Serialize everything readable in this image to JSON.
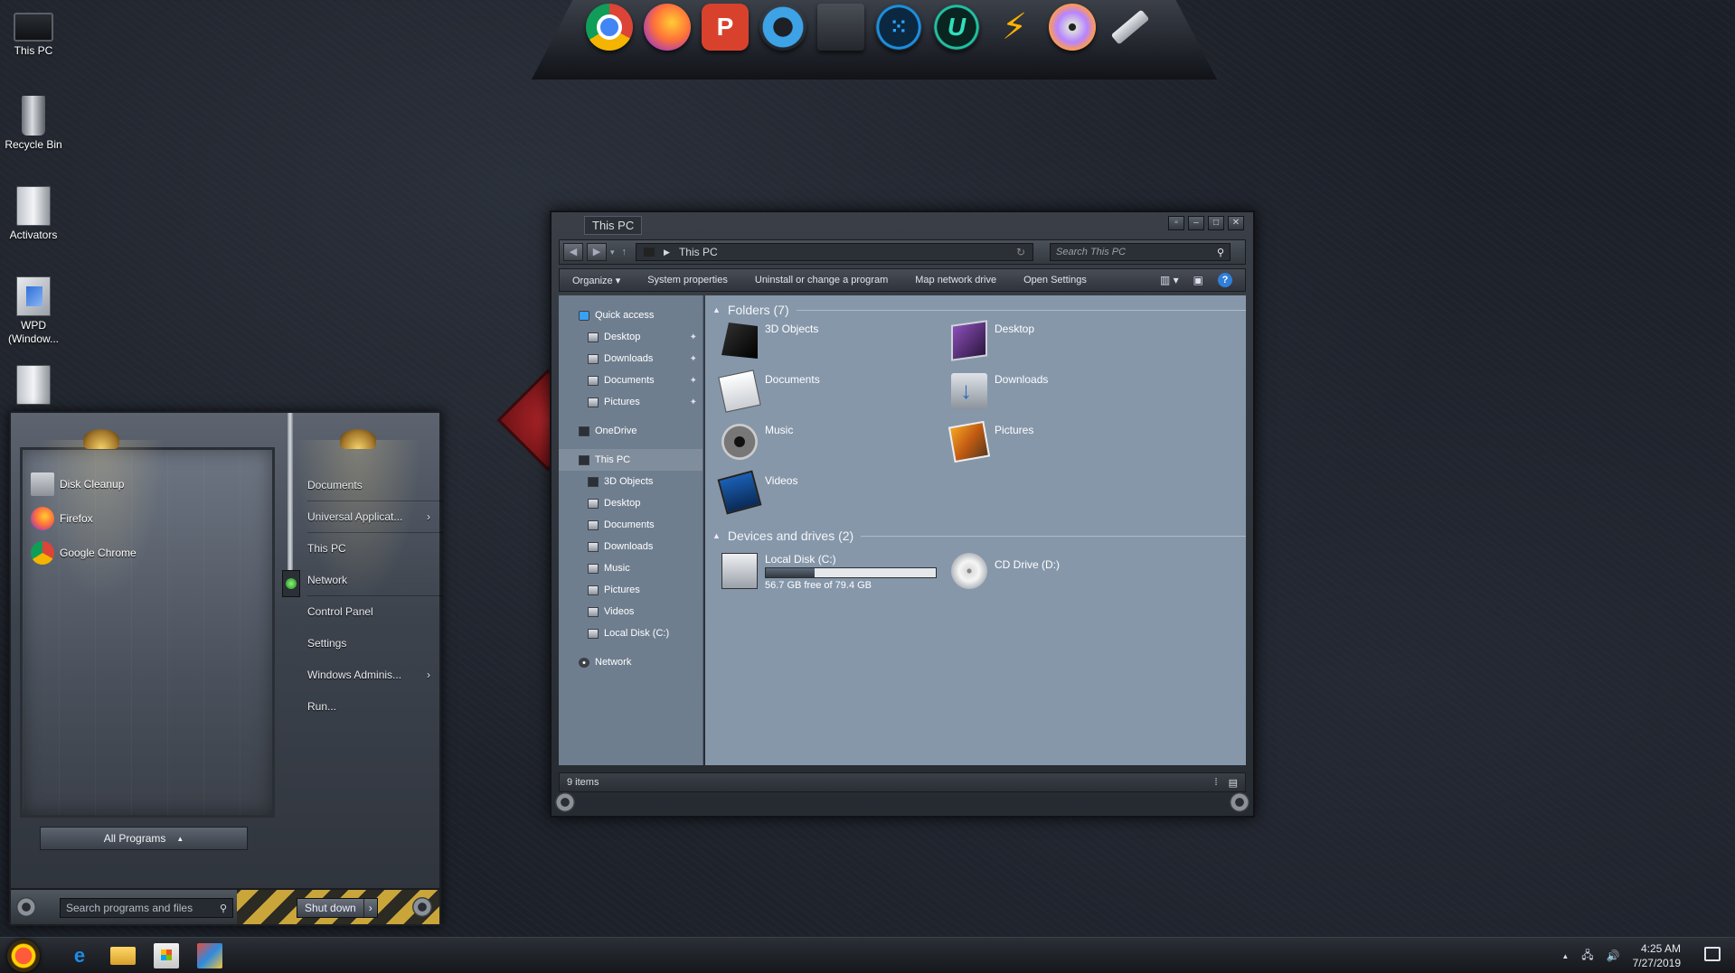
{
  "desktop": {
    "icons": [
      {
        "label": "This PC",
        "icon": "this-pc-icon"
      },
      {
        "label": "Recycle Bin",
        "icon": "recycle-bin-icon"
      },
      {
        "label": "Activators",
        "icon": "folder-icon"
      },
      {
        "label": "WPD (Window...",
        "icon": "wpd-icon"
      },
      {
        "label": "",
        "icon": "folder-icon"
      }
    ]
  },
  "dock": {
    "items": [
      "chrome-icon",
      "firefox-icon",
      "p-icon",
      "settings-gear-icon",
      "system-monitor-icon",
      "dots-app-icon",
      "u-app-icon",
      "lightning-icon",
      "cd-disc-icon",
      "usb-drive-icon"
    ],
    "p_label": "P",
    "u_label": "U"
  },
  "start_menu": {
    "pinned": [
      {
        "label": "Disk Cleanup",
        "icon": "disk-cleanup-icon"
      },
      {
        "label": "Firefox",
        "icon": "firefox-icon"
      },
      {
        "label": "Google Chrome",
        "icon": "chrome-icon"
      }
    ],
    "links": [
      {
        "label": "Documents",
        "arrow": ""
      },
      {
        "label": "Universal Applicat...",
        "arrow": "›"
      },
      {
        "label": "This PC",
        "arrow": ""
      },
      {
        "label": "Network",
        "arrow": ""
      },
      {
        "label": "Control Panel",
        "arrow": ""
      },
      {
        "label": "Settings",
        "arrow": ""
      },
      {
        "label": "Windows Adminis...",
        "arrow": "›"
      },
      {
        "label": "Run...",
        "arrow": ""
      }
    ],
    "all_programs": "All Programs",
    "all_programs_arrow": "▲",
    "search_placeholder": "Search programs and files",
    "shutdown": "Shut down",
    "shutdown_arrow": "›"
  },
  "explorer": {
    "title": "This PC",
    "address": "This PC",
    "search_placeholder": "Search This PC",
    "toolbar": {
      "organize": "Organize ▾",
      "system_properties": "System properties",
      "uninstall": "Uninstall or change a program",
      "map_drive": "Map network drive",
      "open_settings": "Open Settings",
      "help": "?"
    },
    "nav": {
      "quick_access": "Quick access",
      "qa_items": [
        "Desktop",
        "Downloads",
        "Documents",
        "Pictures"
      ],
      "onedrive": "OneDrive",
      "this_pc": "This PC",
      "pc_items": [
        "3D Objects",
        "Desktop",
        "Documents",
        "Downloads",
        "Music",
        "Pictures",
        "Videos",
        "Local Disk (C:)"
      ],
      "network": "Network"
    },
    "folders_header": "Folders (7)",
    "folders": [
      {
        "label": "3D Objects",
        "icon": "3d-objects-icon"
      },
      {
        "label": "Desktop",
        "icon": "desktop-folder-icon"
      },
      {
        "label": "Documents",
        "icon": "documents-icon"
      },
      {
        "label": "Downloads",
        "icon": "downloads-icon"
      },
      {
        "label": "Music",
        "icon": "music-icon"
      },
      {
        "label": "Pictures",
        "icon": "pictures-icon"
      },
      {
        "label": "Videos",
        "icon": "videos-icon"
      }
    ],
    "drives_header": "Devices and drives (2)",
    "drives": {
      "local": {
        "label": "Local Disk (C:)",
        "free": "56.7 GB free of 79.4 GB",
        "used_fraction": 0.286
      },
      "cd": {
        "label": "CD Drive (D:)"
      }
    },
    "status": "9 items"
  },
  "taskbar": {
    "apps": [
      "edge-icon",
      "file-explorer-icon",
      "store-icon",
      "multi-app-icon"
    ],
    "edge_glyph": "e",
    "time": "4:25 AM",
    "date": "7/27/2019",
    "tray_glyphs": {
      "up": "▲",
      "network": "🖧",
      "volume": "🔊"
    }
  }
}
